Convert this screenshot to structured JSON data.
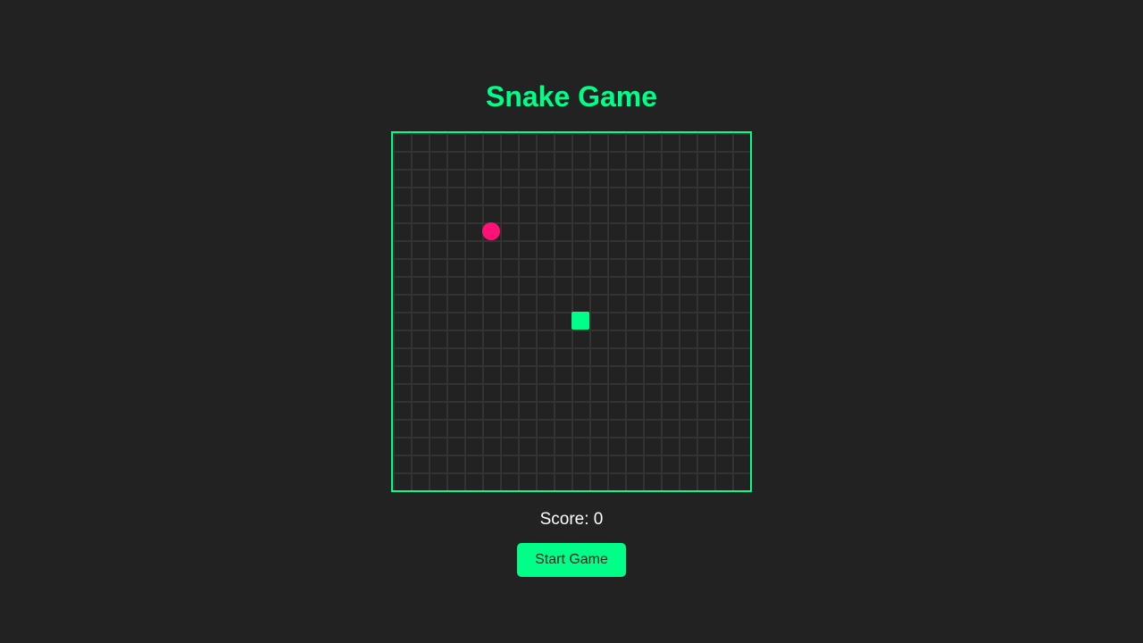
{
  "game": {
    "title": "Snake Game",
    "grid": {
      "columns": 20,
      "rows": 20
    },
    "food": {
      "col": 5,
      "row": 5
    },
    "snake": [
      {
        "col": 10,
        "row": 10
      }
    ],
    "score_text": "Score: 0",
    "start_label": "Start Game"
  },
  "colors": {
    "background": "#222222",
    "accent": "#00ff88",
    "food": "#ff1177",
    "grid_line": "#333333",
    "text": "#ffffff"
  }
}
